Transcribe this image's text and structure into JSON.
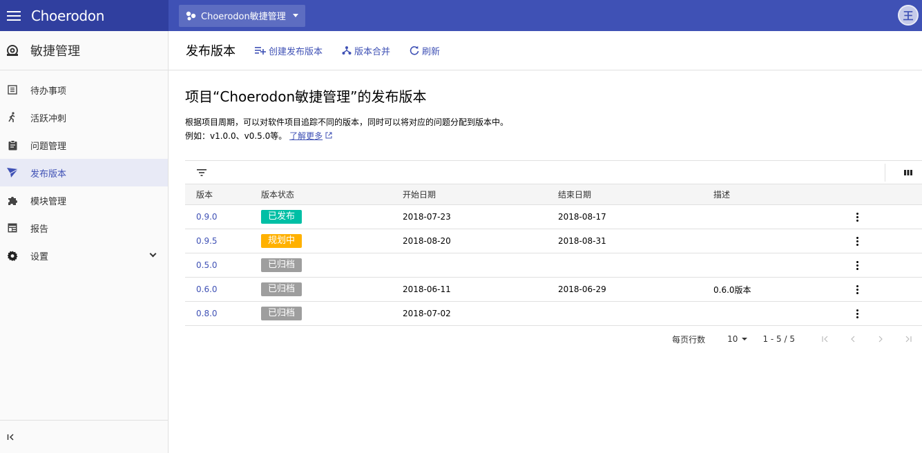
{
  "header": {
    "app_name": "Choerodon",
    "project_name": "Choerodon敏捷管理",
    "avatar_letter": "王",
    "brand_color": "#3f51b5"
  },
  "sidebar": {
    "module_title": "敏捷管理",
    "items": [
      {
        "label": "待办事项",
        "icon": "backlog-icon"
      },
      {
        "label": "活跃冲刺",
        "icon": "running-person-icon"
      },
      {
        "label": "问题管理",
        "icon": "clipboard-icon"
      },
      {
        "label": "发布版本",
        "icon": "send-icon",
        "active": true
      },
      {
        "label": "模块管理",
        "icon": "puzzle-icon"
      },
      {
        "label": "报告",
        "icon": "report-icon"
      },
      {
        "label": "设置",
        "icon": "gear-icon"
      }
    ]
  },
  "page": {
    "title": "发布版本",
    "actions": {
      "create": "创建发布版本",
      "merge": "版本合并",
      "refresh": "刷新"
    },
    "content_title": "项目“Choerodon敏捷管理”的发布版本",
    "desc_line1": "根据项目周期，可以对软件项目追踪不同的版本，同时可以将对应的问题分配到版本中。",
    "desc_line2": "例如：v1.0.0、v0.5.0等。",
    "learn_more": "了解更多"
  },
  "table": {
    "columns": [
      "版本",
      "版本状态",
      "开始日期",
      "结束日期",
      "描述"
    ],
    "rows": [
      {
        "version": "0.9.0",
        "status": "已发布",
        "status_color": "#00bfa5",
        "start": "2018-07-23",
        "end": "2018-08-17",
        "desc": ""
      },
      {
        "version": "0.9.5",
        "status": "规划中",
        "status_color": "#ffb100",
        "start": "2018-08-20",
        "end": "2018-08-31",
        "desc": ""
      },
      {
        "version": "0.5.0",
        "status": "已归档",
        "status_color": "#9e9e9e",
        "start": "",
        "end": "",
        "desc": ""
      },
      {
        "version": "0.6.0",
        "status": "已归档",
        "status_color": "#9e9e9e",
        "start": "2018-06-11",
        "end": "2018-06-29",
        "desc": "0.6.0版本"
      },
      {
        "version": "0.8.0",
        "status": "已归档",
        "status_color": "#9e9e9e",
        "start": "2018-07-02",
        "end": "",
        "desc": ""
      }
    ]
  },
  "pagination": {
    "rows_per_page_label": "每页行数",
    "rows_per_page": "10",
    "range": "1 - 5 / 5"
  }
}
